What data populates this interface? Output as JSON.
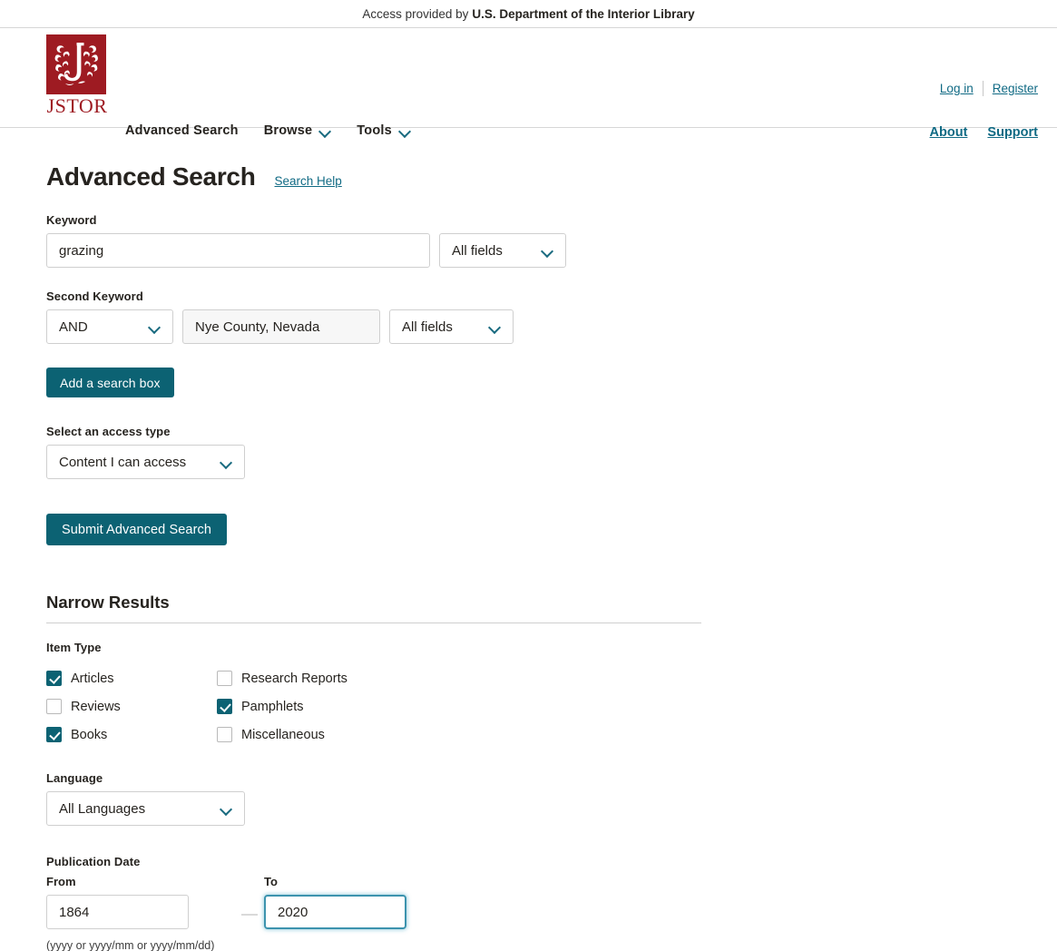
{
  "access_bar": {
    "prefix": "Access provided by",
    "institution": "U.S. Department of the Interior Library"
  },
  "header": {
    "logo_wordmark": "JSTOR",
    "nav": [
      {
        "label": "Advanced Search",
        "has_caret": false
      },
      {
        "label": "Browse",
        "has_caret": true
      },
      {
        "label": "Tools",
        "has_caret": true
      }
    ],
    "account_links": [
      {
        "label": "Log in"
      },
      {
        "label": "Register"
      }
    ],
    "utility_links": [
      {
        "label": "About"
      },
      {
        "label": "Support"
      }
    ]
  },
  "page": {
    "title": "Advanced Search",
    "help_link": "Search Help"
  },
  "search_form": {
    "keyword": {
      "label": "Keyword",
      "value": "grazing",
      "placeholder": "",
      "field_scope": "All fields"
    },
    "second_keyword": {
      "label": "Second Keyword",
      "operator": "AND",
      "value": "Nye County, Nevada",
      "placeholder": "",
      "field_scope": "All fields"
    },
    "add_search_box_label": "Add a search box",
    "access_type": {
      "label": "Select an access type",
      "value": "Content I can access"
    },
    "submit_label": "Submit Advanced Search"
  },
  "narrow_results": {
    "heading": "Narrow Results",
    "item_type": {
      "label": "Item Type",
      "options": [
        {
          "label": "Articles",
          "checked": true
        },
        {
          "label": "Research Reports",
          "checked": false
        },
        {
          "label": "Reviews",
          "checked": false
        },
        {
          "label": "Pamphlets",
          "checked": true
        },
        {
          "label": "Books",
          "checked": true
        },
        {
          "label": "Miscellaneous",
          "checked": false
        }
      ]
    },
    "language": {
      "label": "Language",
      "value": "All Languages"
    },
    "publication_date": {
      "label": "Publication Date",
      "from_label": "From",
      "to_label": "To",
      "from_value": "1864",
      "to_value": "2020",
      "hint": "(yyyy or yyyy/mm or yyyy/mm/dd)"
    }
  },
  "colors": {
    "brand_red": "#9e1b22",
    "teal": "#0c6273",
    "link_teal": "#106a84",
    "focus_teal": "#3c93ae"
  }
}
